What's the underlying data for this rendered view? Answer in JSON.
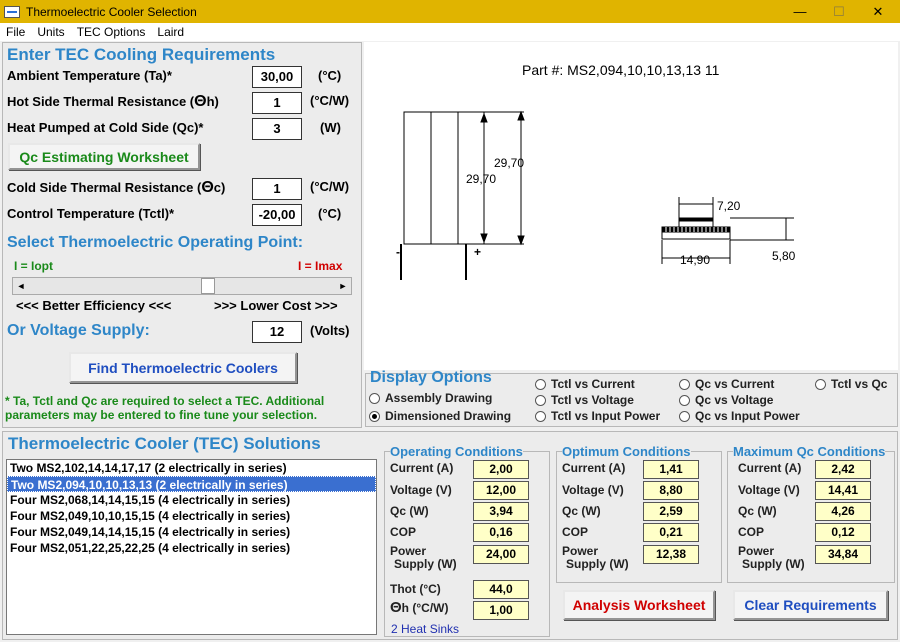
{
  "window": {
    "title": "Thermoelectric Cooler Selection",
    "min": "—",
    "max": "☐",
    "close": "✕"
  },
  "menu": [
    "File",
    "Units",
    "TEC Options",
    "Laird"
  ],
  "requirements": {
    "title": "Enter TEC Cooling Requirements",
    "ambient": {
      "label": "Ambient Temperature (Ta)*",
      "value": "30,00",
      "unit": "(°C)"
    },
    "hot_res": {
      "label_pre": "Hot Side Thermal Resistance (",
      "theta": "Θ",
      "sub": "h",
      "label_post": ")",
      "value": "1",
      "unit": "(°C/W)"
    },
    "heat": {
      "label": "Heat Pumped at Cold Side (Qc)*",
      "value": "3",
      "unit": "(W)"
    },
    "qc_button": "Qc Estimating Worksheet",
    "cold_res": {
      "label_pre": "Cold Side Thermal Resistance (",
      "theta": "Θ",
      "sub": "c",
      "label_post": ")",
      "value": "1",
      "unit": "(°C/W)"
    },
    "control": {
      "label": "Control Temperature (Tctl)*",
      "value": "-20,00",
      "unit": "(°C)"
    },
    "op_title": "Select Thermoelectric Operating Point:",
    "iopt": "I = Iopt",
    "imax": "I = Imax",
    "slider_left": "◄",
    "slider_right": "►",
    "eff": "<<< Better Efficiency <<<",
    "cost": ">>> Lower Cost >>>",
    "voltage": {
      "label": "Or Voltage Supply:",
      "value": "12",
      "unit": "(Volts)"
    },
    "find_button": "Find Thermoelectric Coolers",
    "note": "* Ta, Tctl and Qc are required to select a TEC. Additional parameters may be entered to fine tune your selection."
  },
  "drawing": {
    "part_label": "Part #:",
    "part_no": "MS2,094,10,10,13,13 11",
    "d1": "29,70",
    "d2": "29,70",
    "d3": "7,20",
    "d4": "14,90",
    "d5": "5,80",
    "minus": "-",
    "plus": "+"
  },
  "display": {
    "title": "Display Options",
    "opts": [
      "Assembly Drawing",
      "Dimensioned Drawing",
      "Tctl vs Current",
      "Tctl vs Voltage",
      "Tctl vs Input Power",
      "Qc vs Current",
      "Qc vs Voltage",
      "Qc vs Input Power",
      "Tctl vs Qc"
    ],
    "selected": "Dimensioned Drawing"
  },
  "solutions": {
    "title": "Thermoelectric Cooler (TEC) Solutions",
    "items": [
      "Two MS2,102,14,14,17,17 (2 electrically in series)",
      "Two MS2,094,10,10,13,13 (2 electrically in series)",
      "Four MS2,068,14,14,15,15 (4 electrically in series)",
      "Four MS2,049,10,10,15,15 (4 electrically in series)",
      "Four MS2,049,14,14,15,15 (4 electrically in series)",
      "Four MS2,051,22,25,22,25 (4 electrically in series)"
    ],
    "selected_index": 1
  },
  "operating": {
    "title": "Operating Conditions",
    "current": "2,00",
    "voltage": "12,00",
    "qc": "3,94",
    "cop": "0,16",
    "power": "24,00",
    "thot": "44,0",
    "theta_h": "1,00",
    "heatsinks": "2 Heat Sinks"
  },
  "optimum": {
    "title": "Optimum Conditions",
    "current": "1,41",
    "voltage": "8,80",
    "qc": "2,59",
    "cop": "0,21",
    "power": "12,38"
  },
  "maximum": {
    "title": "Maximum Qc Conditions",
    "current": "2,42",
    "voltage": "14,41",
    "qc": "4,26",
    "cop": "0,12",
    "power": "34,84"
  },
  "labels": {
    "current": "Current (A)",
    "voltage": "Voltage (V)",
    "qc": "Qc (W)",
    "cop": "COP",
    "power1": "Power",
    "power2": "Supply (W)",
    "thot": "Thot (°C)",
    "theta": "Θ",
    "theta_sub": "h",
    "theta_unit": "(°C/W)"
  },
  "buttons": {
    "analysis": "Analysis Worksheet",
    "clear": "Clear Requirements"
  }
}
